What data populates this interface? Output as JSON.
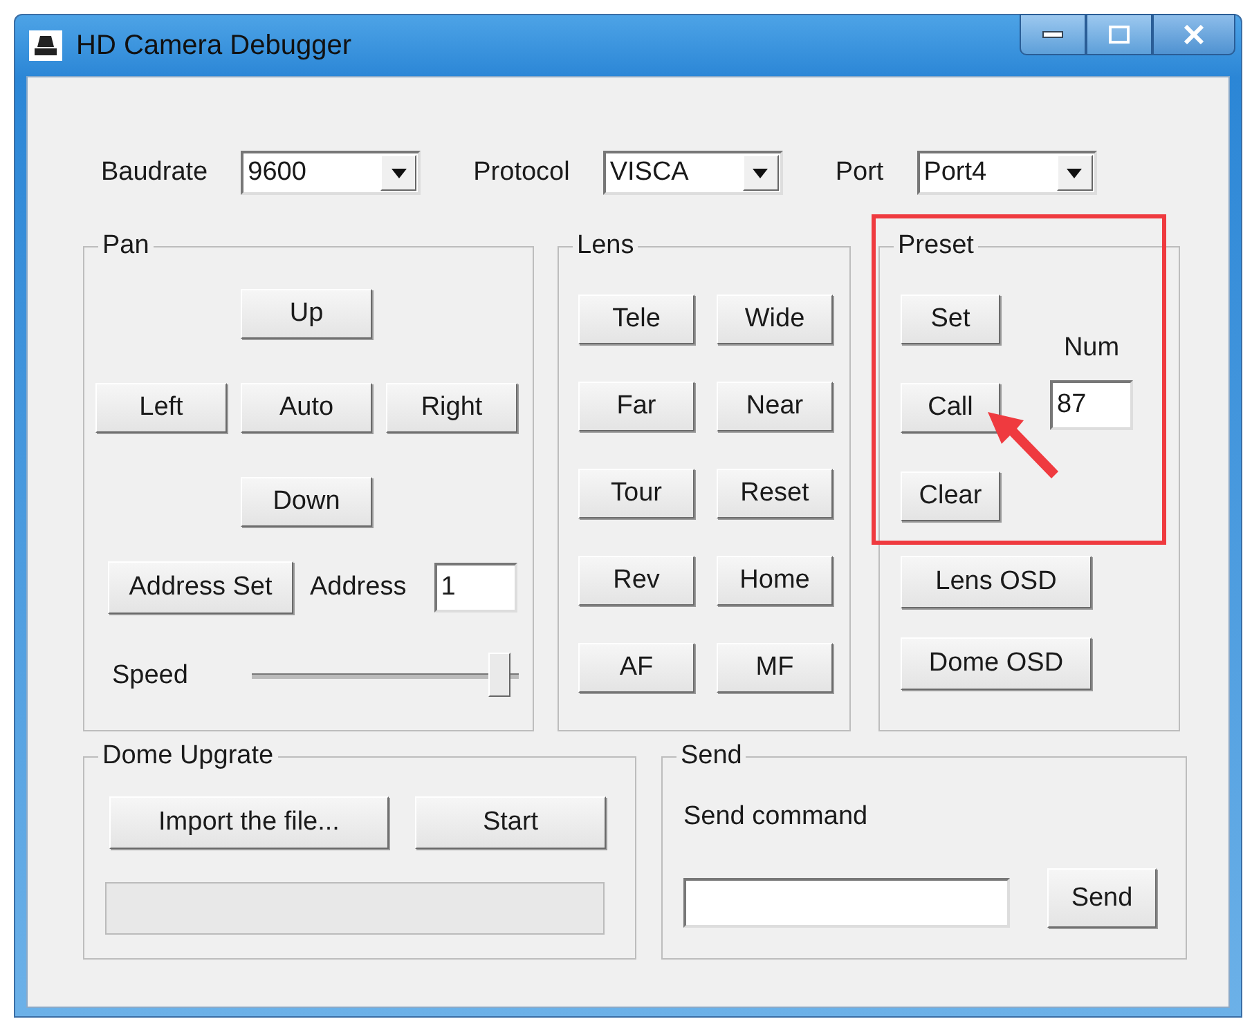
{
  "window": {
    "title": "HD Camera Debugger"
  },
  "settings": [
    {
      "label": "Baudrate",
      "value": "9600"
    },
    {
      "label": "Protocol",
      "value": "VISCA"
    },
    {
      "label": "Port",
      "value": "Port4"
    }
  ],
  "pan": {
    "title": "Pan",
    "buttons": [
      "Up",
      "Left",
      "Auto",
      "Right",
      "Down"
    ],
    "address_button": "Address Set",
    "address_label": "Address",
    "address_value": "1",
    "speed_label": "Speed",
    "speed": {
      "level": 0.93
    }
  },
  "lens": {
    "title": "Lens",
    "buttons": [
      "Tele",
      "Wide",
      "Far",
      "Near",
      "Tour",
      "Reset",
      "Rev",
      "Home",
      "AF",
      "MF"
    ]
  },
  "preset": {
    "title": "Preset",
    "buttons": [
      "Set",
      "Call",
      "Clear"
    ],
    "num_label": "Num",
    "num_value": "87",
    "osd_buttons": [
      "Lens OSD",
      "Dome OSD"
    ]
  },
  "upgrade": {
    "title": "Dome Upgrate",
    "buttons": [
      "Import the file...",
      "Start"
    ]
  },
  "send": {
    "title": "Send",
    "label": "Send command",
    "button": "Send"
  }
}
